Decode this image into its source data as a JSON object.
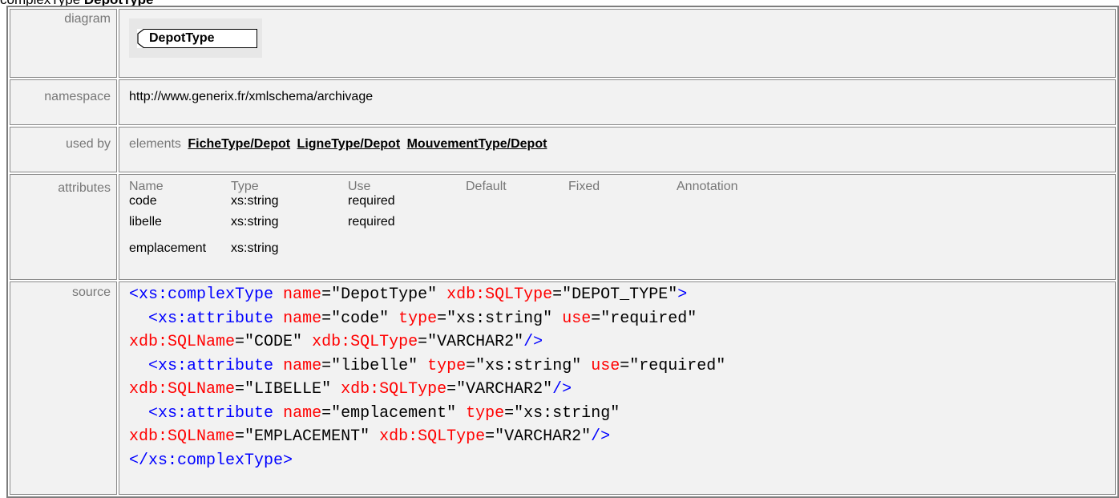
{
  "heading": {
    "prefix": "complexType",
    "name": "DepotType"
  },
  "labels": {
    "diagram": "diagram",
    "namespace": "namespace",
    "used_by": "used by",
    "attributes": "attributes",
    "source": "source"
  },
  "diagram": {
    "node_label": "DepotType"
  },
  "namespace": "http://www.generix.fr/xmlschema/archivage",
  "used_by": {
    "prefix": "elements",
    "links": [
      "FicheType/Depot",
      "LigneType/Depot",
      "MouvementType/Depot"
    ]
  },
  "attributes": {
    "headers": [
      "Name",
      "Type",
      "Use",
      "Default",
      "Fixed",
      "Annotation"
    ],
    "rows": [
      {
        "name": "code",
        "type": "xs:string",
        "use": "required"
      },
      {
        "name": "libelle",
        "type": "xs:string",
        "use": "required"
      },
      {
        "name": "emplacement",
        "type": "xs:string",
        "use": ""
      }
    ]
  },
  "source": {
    "lines": [
      [
        [
          "tag",
          "<xs:complexType"
        ],
        [
          "sp",
          " "
        ],
        [
          "attr",
          "name"
        ],
        [
          "eq",
          "="
        ],
        [
          "val",
          "\"DepotType\""
        ],
        [
          "sp",
          " "
        ],
        [
          "attr",
          "xdb:SQLType"
        ],
        [
          "eq",
          "="
        ],
        [
          "val",
          "\"DEPOT_TYPE\""
        ],
        [
          "tag",
          ">"
        ]
      ],
      [
        [
          "sp",
          "  "
        ],
        [
          "tag",
          "<xs:attribute"
        ],
        [
          "sp",
          " "
        ],
        [
          "attr",
          "name"
        ],
        [
          "eq",
          "="
        ],
        [
          "val",
          "\"code\""
        ],
        [
          "sp",
          " "
        ],
        [
          "attr",
          "type"
        ],
        [
          "eq",
          "="
        ],
        [
          "val",
          "\"xs:string\""
        ],
        [
          "sp",
          " "
        ],
        [
          "attr",
          "use"
        ],
        [
          "eq",
          "="
        ],
        [
          "val",
          "\"required\""
        ]
      ],
      [
        [
          "attr",
          "xdb:SQLName"
        ],
        [
          "eq",
          "="
        ],
        [
          "val",
          "\"CODE\""
        ],
        [
          "sp",
          " "
        ],
        [
          "attr",
          "xdb:SQLType"
        ],
        [
          "eq",
          "="
        ],
        [
          "val",
          "\"VARCHAR2\""
        ],
        [
          "tag",
          "/>"
        ]
      ],
      [
        [
          "sp",
          "  "
        ],
        [
          "tag",
          "<xs:attribute"
        ],
        [
          "sp",
          " "
        ],
        [
          "attr",
          "name"
        ],
        [
          "eq",
          "="
        ],
        [
          "val",
          "\"libelle\""
        ],
        [
          "sp",
          " "
        ],
        [
          "attr",
          "type"
        ],
        [
          "eq",
          "="
        ],
        [
          "val",
          "\"xs:string\""
        ],
        [
          "sp",
          " "
        ],
        [
          "attr",
          "use"
        ],
        [
          "eq",
          "="
        ],
        [
          "val",
          "\"required\""
        ]
      ],
      [
        [
          "attr",
          "xdb:SQLName"
        ],
        [
          "eq",
          "="
        ],
        [
          "val",
          "\"LIBELLE\""
        ],
        [
          "sp",
          " "
        ],
        [
          "attr",
          "xdb:SQLType"
        ],
        [
          "eq",
          "="
        ],
        [
          "val",
          "\"VARCHAR2\""
        ],
        [
          "tag",
          "/>"
        ]
      ],
      [
        [
          "sp",
          "  "
        ],
        [
          "tag",
          "<xs:attribute"
        ],
        [
          "sp",
          " "
        ],
        [
          "attr",
          "name"
        ],
        [
          "eq",
          "="
        ],
        [
          "val",
          "\"emplacement\""
        ],
        [
          "sp",
          " "
        ],
        [
          "attr",
          "type"
        ],
        [
          "eq",
          "="
        ],
        [
          "val",
          "\"xs:string\""
        ]
      ],
      [
        [
          "attr",
          "xdb:SQLName"
        ],
        [
          "eq",
          "="
        ],
        [
          "val",
          "\"EMPLACEMENT\""
        ],
        [
          "sp",
          " "
        ],
        [
          "attr",
          "xdb:SQLType"
        ],
        [
          "eq",
          "="
        ],
        [
          "val",
          "\"VARCHAR2\""
        ],
        [
          "tag",
          "/>"
        ]
      ],
      [
        [
          "tag",
          "</xs:complexType>"
        ]
      ]
    ]
  },
  "colors": {
    "xml_tag": "#0000ff",
    "xml_attribute": "#ff0000",
    "label_text": "#777777",
    "cell_background": "#f2f2f2"
  }
}
